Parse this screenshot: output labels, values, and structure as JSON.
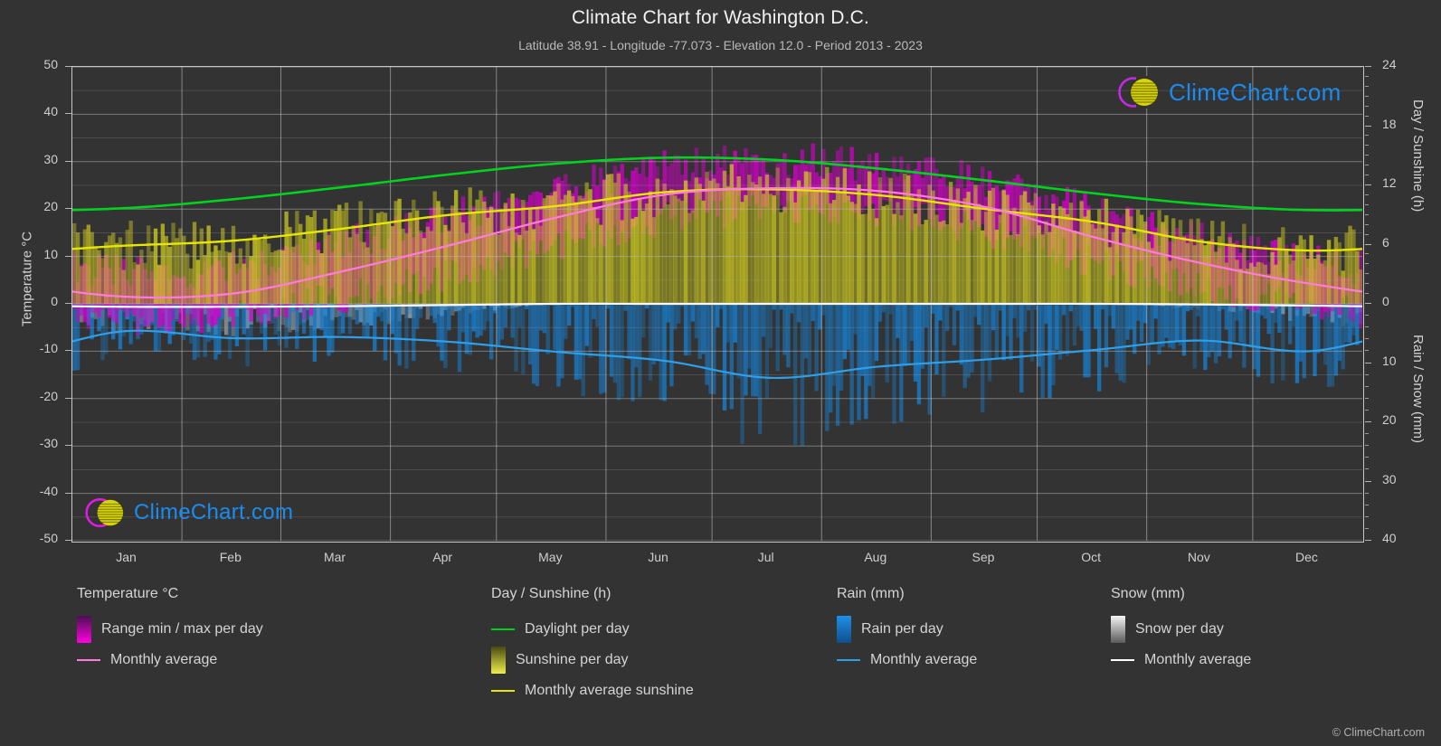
{
  "header": {
    "title": "Climate Chart for Washington D.C.",
    "subtitle": "Latitude 38.91 - Longitude -77.073 - Elevation 12.0 - Period 2013 - 2023"
  },
  "watermark": {
    "text": "ClimeChart.com"
  },
  "footer": {
    "copyright": "© ClimeChart.com"
  },
  "axes": {
    "left_title": "Temperature °C",
    "right_title_top": "Day / Sunshine (h)",
    "right_title_bottom": "Rain / Snow (mm)"
  },
  "legend": {
    "columns": [
      {
        "heading": "Temperature °C",
        "items": [
          {
            "label": "Range min / max per day",
            "marker": "swatch",
            "color": "#ff00e0"
          },
          {
            "label": "Monthly average",
            "marker": "line",
            "color": "#ff7bdd"
          }
        ]
      },
      {
        "heading": "Day / Sunshine (h)",
        "items": [
          {
            "label": "Daylight per day",
            "marker": "line",
            "color": "#00d21e"
          },
          {
            "label": "Sunshine per day",
            "marker": "swatch",
            "color": "#e8e83c"
          },
          {
            "label": "Monthly average sunshine",
            "marker": "line",
            "color": "#e6e600"
          }
        ]
      },
      {
        "heading": "Rain (mm)",
        "items": [
          {
            "label": "Rain per day",
            "marker": "swatch",
            "color": "#1e90e8"
          },
          {
            "label": "Monthly average",
            "marker": "line",
            "color": "#2e9fe8"
          }
        ]
      },
      {
        "heading": "Snow (mm)",
        "items": [
          {
            "label": "Snow per day",
            "marker": "swatch",
            "color": "#dcdcdc"
          },
          {
            "label": "Monthly average",
            "marker": "line",
            "color": "#ffffff"
          }
        ]
      }
    ]
  },
  "chart_data": {
    "type": "line",
    "title": "Climate Chart for Washington D.C.",
    "subtitle": "Latitude 38.91 - Longitude -77.073 - Elevation 12.0 - Period 2013 - 2023",
    "xlabel": "",
    "ylabel": "Temperature °C",
    "y2label_top": "Day / Sunshine (h)",
    "y2label_bottom": "Rain / Snow (mm)",
    "grid": true,
    "legend_position": "below",
    "x_tick_labels": [
      "Jan",
      "Feb",
      "Mar",
      "Apr",
      "May",
      "Jun",
      "Jul",
      "Aug",
      "Sep",
      "Oct",
      "Nov",
      "Dec"
    ],
    "y_left_ticks": [
      50,
      40,
      30,
      20,
      10,
      0,
      -10,
      -20,
      -30,
      -40,
      -50
    ],
    "y_left_lim": [
      -50,
      50
    ],
    "y_right_top_ticks": [
      24,
      18,
      12,
      6,
      0
    ],
    "y_right_top_lim": [
      0,
      24
    ],
    "y_right_bottom_ticks": [
      0,
      10,
      20,
      30,
      40
    ],
    "y_right_bottom_lim": [
      0,
      40
    ],
    "months": [
      "Jan",
      "Feb",
      "Mar",
      "Apr",
      "May",
      "Jun",
      "Jul",
      "Aug",
      "Sep",
      "Oct",
      "Nov",
      "Dec"
    ],
    "series": [
      {
        "name": "Daylight per day",
        "unit": "h",
        "color": "#00d21e",
        "values": [
          9.7,
          10.6,
          11.8,
          13.1,
          14.2,
          14.8,
          14.6,
          13.7,
          12.5,
          11.2,
          10.1,
          9.5
        ]
      },
      {
        "name": "Monthly average sunshine",
        "unit": "h",
        "color": "#e6e600",
        "values": [
          5.9,
          6.4,
          7.6,
          9.0,
          9.9,
          11.3,
          11.6,
          11.0,
          9.6,
          8.3,
          6.3,
          5.4
        ]
      },
      {
        "name": "Monthly average temperature",
        "unit": "°C",
        "color": "#ff7bdd",
        "values": [
          1.5,
          2.2,
          6.8,
          12.3,
          18.2,
          23.0,
          24.4,
          23.8,
          20.4,
          14.1,
          8.6,
          4.3
        ]
      },
      {
        "name": "Monthly average rain",
        "unit": "mm",
        "color": "#2e9fe8",
        "values": [
          4.6,
          5.8,
          5.6,
          6.4,
          8.1,
          9.6,
          12.5,
          10.6,
          9.4,
          7.8,
          6.2,
          8.0
        ]
      },
      {
        "name": "Monthly average snow",
        "unit": "mm",
        "color": "#ffffff",
        "values": [
          0.5,
          0.5,
          0.4,
          0.2,
          0.0,
          0.0,
          0.0,
          0.0,
          0.0,
          0.0,
          0.1,
          0.3
        ]
      },
      {
        "name": "Daily max temperature",
        "unit": "°C",
        "color": "#ff00e0",
        "values": [
          6.5,
          7.8,
          12.6,
          18.4,
          23.8,
          28.6,
          30.2,
          29.3,
          25.8,
          19.5,
          13.6,
          9.2
        ]
      },
      {
        "name": "Daily min temperature",
        "unit": "°C",
        "color": "#ff00e0",
        "values": [
          -3.2,
          -2.6,
          1.4,
          6.2,
          12.4,
          17.8,
          19.8,
          19.2,
          15.3,
          8.8,
          3.4,
          -0.6
        ]
      }
    ]
  }
}
